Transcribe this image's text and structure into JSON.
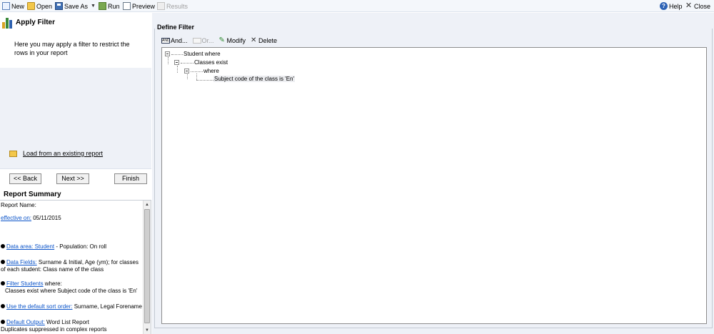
{
  "toolbar": {
    "new": "New",
    "open": "Open",
    "save_as": "Save As",
    "run": "Run",
    "preview": "Preview",
    "results": "Results",
    "help": "Help",
    "close": "Close"
  },
  "left": {
    "title": "Apply Filter",
    "description": "Here you may apply a filter to  restrict the rows in your report",
    "load_link": "Load from an existing report",
    "back": "<< Back",
    "next": "Next >>",
    "finish": "Finish"
  },
  "summary": {
    "title": "Report Summary",
    "report_name_label": "Report Name:",
    "effective_link": "effective on:",
    "effective_value": " 05/11/2015",
    "data_area_link": "Data area: Student",
    "data_area_value": " - Population: On roll",
    "data_fields_link": "Data Fields:",
    "data_fields_value": " Surname & Initial, Age (ym); for classes of each student: Class name of the class",
    "filter_link": "Filter Students",
    "filter_value": " where:",
    "filter_detail": "Classes exist where Subject code of the class is 'En'",
    "sort_link": "Use the default sort order:",
    "sort_value": " Surname, Legal Forename",
    "output_link": "Default Output:",
    "output_value": " Word List Report",
    "output_detail": "Duplicates suppressed in complex reports"
  },
  "define": {
    "title": "Define Filter",
    "and": "And...",
    "and_icon_text": "AND",
    "or": "Or...",
    "modify": "Modify",
    "delete": "Delete"
  },
  "tree": {
    "n1": "Student where",
    "n2": "Classes exist",
    "n3": "where",
    "n4": "Subject code of the class is 'En'"
  },
  "colors": {
    "link_blue": "#0b54c9",
    "panel_bg": "#eef1f7"
  }
}
